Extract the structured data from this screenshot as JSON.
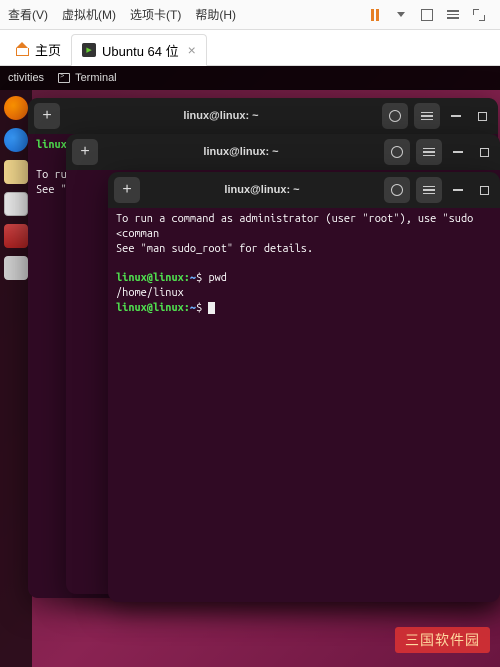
{
  "host": {
    "menu": {
      "view": "查看(V)",
      "vm": "虚拟机(M)",
      "tabs": "选项卡(T)",
      "help": "帮助(H)"
    },
    "tabs": {
      "home": "主页",
      "ubuntu": "Ubuntu 64 位"
    }
  },
  "gnome": {
    "activities": "ctivities",
    "terminal_label": "Terminal"
  },
  "terminals": {
    "title": "linux@linux: ~",
    "bg_prompt_user": "linux@",
    "bg_line1": "To run",
    "bg_line2": "See \"m",
    "front": {
      "sudo_line1": "To run a command as administrator (user \"root\"), use \"sudo <comman",
      "sudo_line2": "See \"man sudo_root\" for details.",
      "prompt_user": "linux@linux:",
      "prompt_path": "~",
      "prompt_symbol": "$",
      "cmd1": "pwd",
      "output1": "/home/linux"
    }
  },
  "watermark": "三国软件园"
}
